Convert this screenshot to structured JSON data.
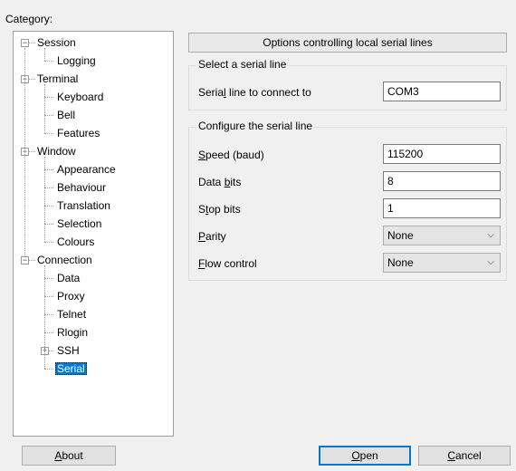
{
  "category": {
    "prefix": "Cate",
    "accel": "g",
    "suffix": "ory:"
  },
  "tree": [
    {
      "label": "Session",
      "level": 0,
      "expander": "−",
      "name": "tree-item-session"
    },
    {
      "label": "Logging",
      "level": 1,
      "name": "tree-item-logging"
    },
    {
      "label": "Terminal",
      "level": 0,
      "expander": "−",
      "name": "tree-item-terminal"
    },
    {
      "label": "Keyboard",
      "level": 1,
      "name": "tree-item-keyboard"
    },
    {
      "label": "Bell",
      "level": 1,
      "name": "tree-item-bell"
    },
    {
      "label": "Features",
      "level": 1,
      "name": "tree-item-features"
    },
    {
      "label": "Window",
      "level": 0,
      "expander": "−",
      "name": "tree-item-window"
    },
    {
      "label": "Appearance",
      "level": 1,
      "name": "tree-item-appearance"
    },
    {
      "label": "Behaviour",
      "level": 1,
      "name": "tree-item-behaviour"
    },
    {
      "label": "Translation",
      "level": 1,
      "name": "tree-item-translation"
    },
    {
      "label": "Selection",
      "level": 1,
      "name": "tree-item-selection"
    },
    {
      "label": "Colours",
      "level": 1,
      "name": "tree-item-colours"
    },
    {
      "label": "Connection",
      "level": 0,
      "expander": "−",
      "name": "tree-item-connection"
    },
    {
      "label": "Data",
      "level": 1,
      "name": "tree-item-data"
    },
    {
      "label": "Proxy",
      "level": 1,
      "name": "tree-item-proxy"
    },
    {
      "label": "Telnet",
      "level": 1,
      "name": "tree-item-telnet"
    },
    {
      "label": "Rlogin",
      "level": 1,
      "name": "tree-item-rlogin"
    },
    {
      "label": "SSH",
      "level": 1,
      "expander": "+",
      "name": "tree-item-ssh"
    },
    {
      "label": "Serial",
      "level": 1,
      "selected": true,
      "name": "tree-item-serial"
    }
  ],
  "panel": {
    "header": "Options controlling local serial lines",
    "select_group": {
      "title": "Select a serial line",
      "line_label": {
        "before": "Seria",
        "accel": "l",
        "after": " line to connect to"
      },
      "line_value": "COM3"
    },
    "config_group": {
      "title": "Configure the serial line",
      "speed_label": {
        "before": "",
        "accel": "S",
        "after": "peed (baud)"
      },
      "speed_value": "115200",
      "databits_label": {
        "before": "Data ",
        "accel": "b",
        "after": "its"
      },
      "databits_value": "8",
      "stopbits_label": {
        "before": "S",
        "accel": "t",
        "after": "op bits"
      },
      "stopbits_value": "1",
      "parity_label": {
        "before": "",
        "accel": "P",
        "after": "arity"
      },
      "parity_value": "None",
      "flow_label": {
        "before": "",
        "accel": "F",
        "after": "low control"
      },
      "flow_value": "None"
    }
  },
  "buttons": {
    "about": {
      "before": "",
      "accel": "A",
      "after": "bout"
    },
    "open": {
      "before": "",
      "accel": "O",
      "after": "pen"
    },
    "cancel": {
      "before": "",
      "accel": "C",
      "after": "ancel"
    }
  },
  "colors": {
    "selection": "#0078d7",
    "window_bg": "#f0f0f0"
  }
}
